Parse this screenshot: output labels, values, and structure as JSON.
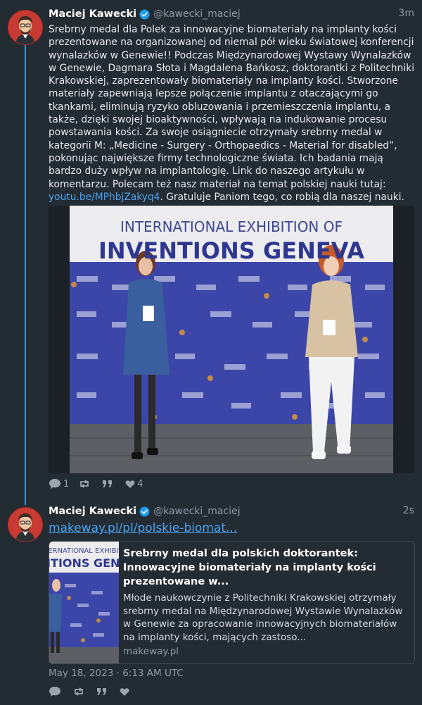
{
  "post1": {
    "display_name": "Maciej Kawecki",
    "handle": "@kawecki_maciej",
    "time": "3m",
    "text_before_link": "Srebrny medal dla Polek za innowacyjne biomateriały na implanty kości prezentowane na organizowanej od niemal pół wieku światowej konferencji wynalazków w Genewie!! Podczas Międzynarodowej Wystawy Wynalazków w Genewie, Dagmara Słota i Magdalena Bańkosz, doktorantki z Politechniki Krakowskiej, zaprezentowały biomateriały na implanty kości. Stworzone materiały zapewniają lepsze połączenie implantu z otaczającymi go tkankami, eliminują ryzyko obluzowania i przemieszczenia implantu, a także, dzięki swojej bioaktywności, wpływają na indukowanie procesu powstawania kości. Za swoje osiągniecie otrzymały srebrny medal w kategorii M: „Medicine - Surgery - Orthopaedics - Material for disabled”, pokonując największe firmy technologiczne świata. Ich badania mają bardzo duży wpływ na implantologię. Link do naszego artykułu w komentarzu. Polecam też nasz materiał na temat polskiej nauki tutaj: ",
    "link_text": "youtu.be/MPhbjZakyq4",
    "text_after_link": ". Gratuluje Paniom tego, co robią dla naszej nauki.",
    "banner_line1": "INTERNATIONAL EXHIBITION OF",
    "banner_line2": "INVENTIONS GENEVA",
    "replies": "1",
    "likes": "4"
  },
  "post2": {
    "display_name": "Maciej Kawecki",
    "handle": "@kawecki_maciej",
    "time": "2s",
    "link_url": "makeway.pl/pl/polskie-biomat...",
    "card": {
      "thumb_line1": "NTERNATIONAL EXHIBITIO",
      "thumb_line2": "NTIONS GENE",
      "title": "Srebrny medal dla polskich doktorantek: Innowacyjne biomateriały na implanty kości prezentowane w...",
      "description": "Młode naukowczynie z Politechniki Krakowskiej otrzymały srebrny medal na Międzynarodowej Wystawie Wynalazków w Genewie za opracowanie innowacyjnych biomateriałów na implanty kości, mających zastoso...",
      "domain": "makeway.pl"
    },
    "date": "May 18, 2023 · 6:13 AM UTC"
  },
  "icons": [
    "avatar",
    "verified-badge-icon",
    "reply-icon",
    "retweet-icon",
    "quote-icon",
    "heart-icon"
  ],
  "colors": {
    "background": "#232b33",
    "accent": "#4ba3f0",
    "thread": "#3a8fd6",
    "verified": "#1d9bf0"
  }
}
